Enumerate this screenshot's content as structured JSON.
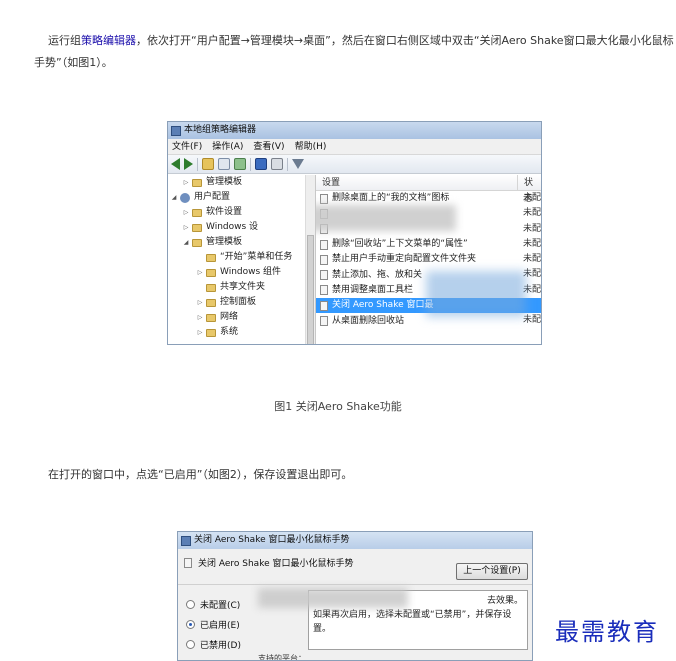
{
  "article": {
    "p1_pre": "运行组",
    "p1_link": "策略编辑器",
    "p1_post": "，依次打开“用户配置→管理模块→桌面”，然后在窗口右侧区域中双击“关闭Aero Shake窗口最大化最小化鼠标手势”（如图1）。",
    "caption1": "图1 关闭Aero Shake功能",
    "p2": "在打开的窗口中，点选“已启用”（如图2），保存设置退出即可。"
  },
  "editor": {
    "title": "本地组策略编辑器",
    "menu": [
      "文件(F)",
      "操作(A)",
      "查看(V)",
      "帮助(H)"
    ],
    "tree": [
      {
        "arrow": "▷",
        "label": "管理模板",
        "indent": 14,
        "icon": "folder"
      },
      {
        "arrow": "◢",
        "label": "用户配置",
        "indent": 2,
        "icon": "user"
      },
      {
        "arrow": "▷",
        "label": "软件设置",
        "indent": 14,
        "icon": "folder"
      },
      {
        "arrow": "▷",
        "label": "Windows 设",
        "indent": 14,
        "icon": "folder"
      },
      {
        "arrow": "◢",
        "label": "管理模板",
        "indent": 14,
        "icon": "folder"
      },
      {
        "arrow": "",
        "label": "“开始”菜单和任务",
        "indent": 28,
        "icon": "folder"
      },
      {
        "arrow": "▷",
        "label": "Windows 组件",
        "indent": 28,
        "icon": "folder"
      },
      {
        "arrow": "",
        "label": "共享文件夹",
        "indent": 28,
        "icon": "folder"
      },
      {
        "arrow": "▷",
        "label": "控制面板",
        "indent": 28,
        "icon": "folder"
      },
      {
        "arrow": "▷",
        "label": "网络",
        "indent": 28,
        "icon": "folder"
      },
      {
        "arrow": "▷",
        "label": "系统",
        "indent": 28,
        "icon": "folder"
      }
    ],
    "col_setting": "设置",
    "col_state": "状态",
    "rows": [
      {
        "label": "删除桌面上的“我的文档”图标",
        "state": "未配",
        "selected": false
      },
      {
        "label": "",
        "state": "未配",
        "selected": false
      },
      {
        "label": "",
        "state": "未配",
        "selected": false
      },
      {
        "label": "删除“回收站”上下文菜单的“属性”",
        "state": "未配",
        "selected": false
      },
      {
        "label": "禁止用户手动重定向配置文件文件夹",
        "state": "未配",
        "selected": false
      },
      {
        "label": "禁止添加、拖、放和关",
        "state": "未配",
        "selected": false
      },
      {
        "label": "禁用调整桌面工具栏",
        "state": "未配",
        "selected": false
      },
      {
        "label": "关闭 Aero Shake 窗口最",
        "state": "",
        "selected": true
      },
      {
        "label": "从桌面删除回收站",
        "state": "未配",
        "selected": false
      }
    ]
  },
  "dialog": {
    "title": "关闭 Aero Shake 窗口最小化鼠标手势",
    "heading": "关闭 Aero Shake 窗口最小化鼠标手势",
    "prev_button": "上一个设置(P)",
    "radios": [
      {
        "label": "未配置(C)",
        "checked": false
      },
      {
        "label": "已启用(E)",
        "checked": true
      },
      {
        "label": "已禁用(D)",
        "checked": false
      }
    ],
    "comment_line1": "去效果。",
    "comment_line2": "如果再次启用，选择未配置或“已禁用”，并保存设置。",
    "support_label": "支持的平台："
  },
  "watermark": "最需教育"
}
